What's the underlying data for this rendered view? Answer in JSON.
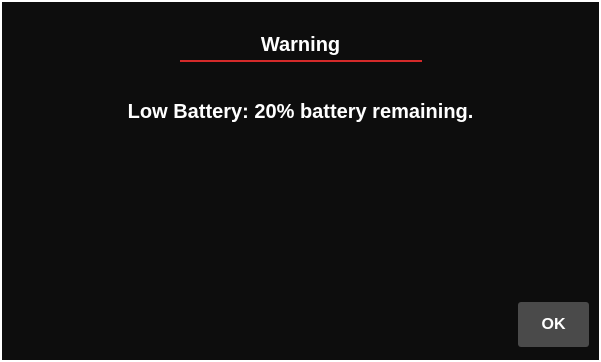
{
  "dialog": {
    "title": "Warning",
    "message": "Low Battery: 20% battery remaining.",
    "ok_label": "OK",
    "accent_color": "#d42a2a",
    "background_color": "#0d0d0d",
    "button_color": "#4a4a4a"
  }
}
